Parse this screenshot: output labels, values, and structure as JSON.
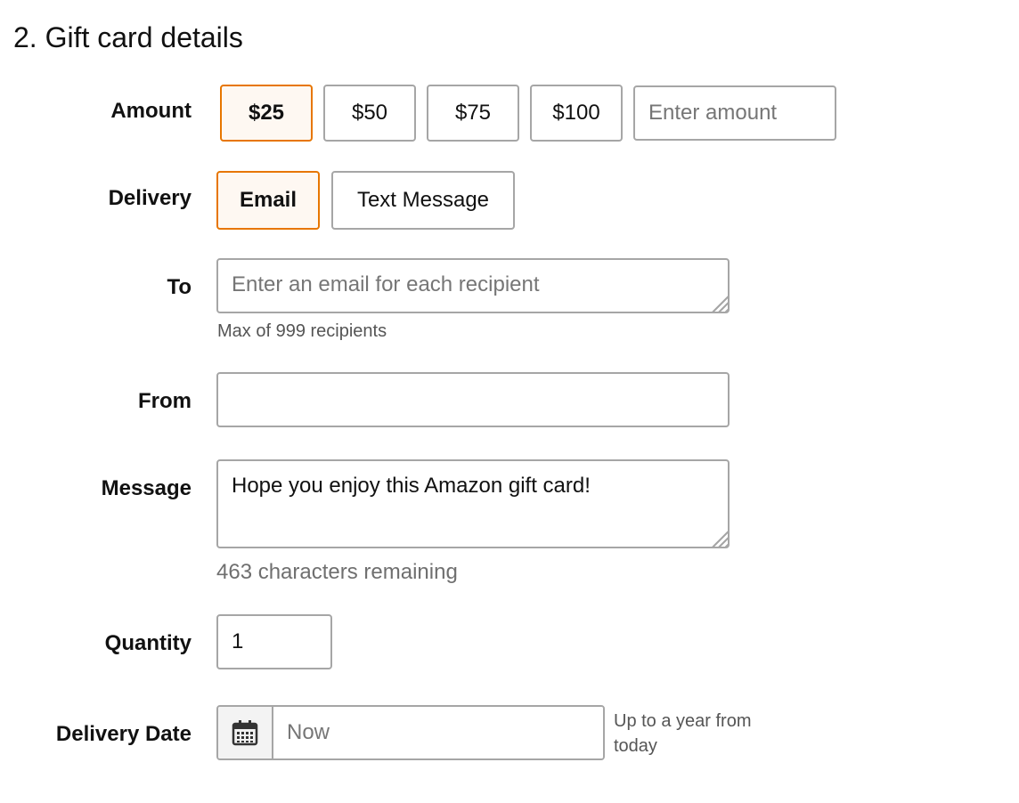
{
  "section": {
    "title": "2. Gift card details"
  },
  "amount": {
    "label": "Amount",
    "options": [
      "$25",
      "$50",
      "$75",
      "$100"
    ],
    "selected": "$25",
    "custom_placeholder": "Enter amount"
  },
  "delivery": {
    "label": "Delivery",
    "options": [
      "Email",
      "Text Message"
    ],
    "selected": "Email"
  },
  "to": {
    "label": "To",
    "placeholder": "Enter an email for each recipient",
    "hint": "Max of 999 recipients"
  },
  "from": {
    "label": "From",
    "value": ""
  },
  "message": {
    "label": "Message",
    "value": "Hope you enjoy this Amazon gift card!",
    "remaining": "463 characters remaining"
  },
  "quantity": {
    "label": "Quantity",
    "value": "1"
  },
  "delivery_date": {
    "label": "Delivery Date",
    "placeholder": "Now",
    "hint": "Up to a year from today",
    "icon": "calendar-icon"
  },
  "colors": {
    "selected_border": "#e77600",
    "selected_bg": "#fef8f2",
    "border": "#a6a6a6"
  }
}
